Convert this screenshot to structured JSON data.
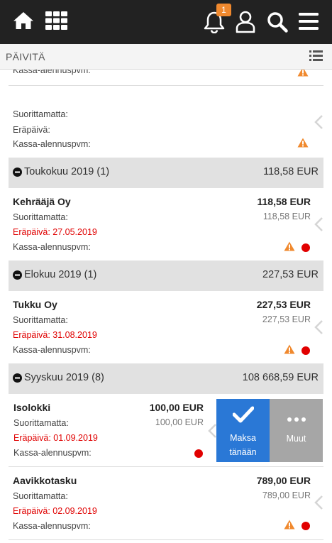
{
  "topbar": {
    "home_icon": "home-icon",
    "apps_icon": "grid-icon",
    "bell_icon": "bell-icon",
    "notification_count": "1",
    "user_icon": "user-icon",
    "search_icon": "search-icon",
    "menu_icon": "hamburger-icon"
  },
  "subbar": {
    "refresh_label": "PÄIVITÄ",
    "list_icon": "list-icon"
  },
  "labels": {
    "unpaid": "Suorittamatta:",
    "due": "Eräpäivä:",
    "discount": "Kassa-alennuspvm:"
  },
  "partial_top": {
    "discount": "Kassa-alennuspvm:"
  },
  "item_blank": {
    "unpaid": "Suorittamatta:",
    "due": "Eräpäivä:",
    "discount": "Kassa-alennuspvm:"
  },
  "groups": [
    {
      "title": "Toukokuu 2019 (1)",
      "total": "118,58 EUR"
    },
    {
      "title": "Elokuu 2019 (1)",
      "total": "227,53 EUR"
    },
    {
      "title": "Syyskuu 2019 (8)",
      "total": "108 668,59 EUR"
    }
  ],
  "items": [
    {
      "name": "Kehrääjä Oy",
      "amount": "118,58 EUR",
      "unpaid_amount": "118,58 EUR",
      "due": "Eräpäivä: 27.05.2019",
      "discount": "Kassa-alennuspvm:"
    },
    {
      "name": "Tukku Oy",
      "amount": "227,53 EUR",
      "unpaid_amount": "227,53 EUR",
      "due": "Eräpäivä: 31.08.2019",
      "discount": "Kassa-alennuspvm:"
    },
    {
      "name": "Isolokki",
      "amount": "100,00 EUR",
      "unpaid_amount": "100,00 EUR",
      "due": "Eräpäivä: 01.09.2019",
      "discount": "Kassa-alennuspvm:"
    },
    {
      "name": "Aavikkotasku",
      "amount": "789,00 EUR",
      "unpaid_amount": "789,00 EUR",
      "due": "Eräpäivä: 02.09.2019",
      "discount": "Kassa-alennuspvm:"
    }
  ],
  "swipe_actions": {
    "pay_today_line1": "Maksa",
    "pay_today_line2": "tänään",
    "other_label": "Muut",
    "pay_color": "#2a78d6",
    "other_color": "#a6a6a6"
  },
  "colors": {
    "warning": "#f0892e",
    "overdue_dot": "#e10000",
    "due_text": "#e00000"
  }
}
